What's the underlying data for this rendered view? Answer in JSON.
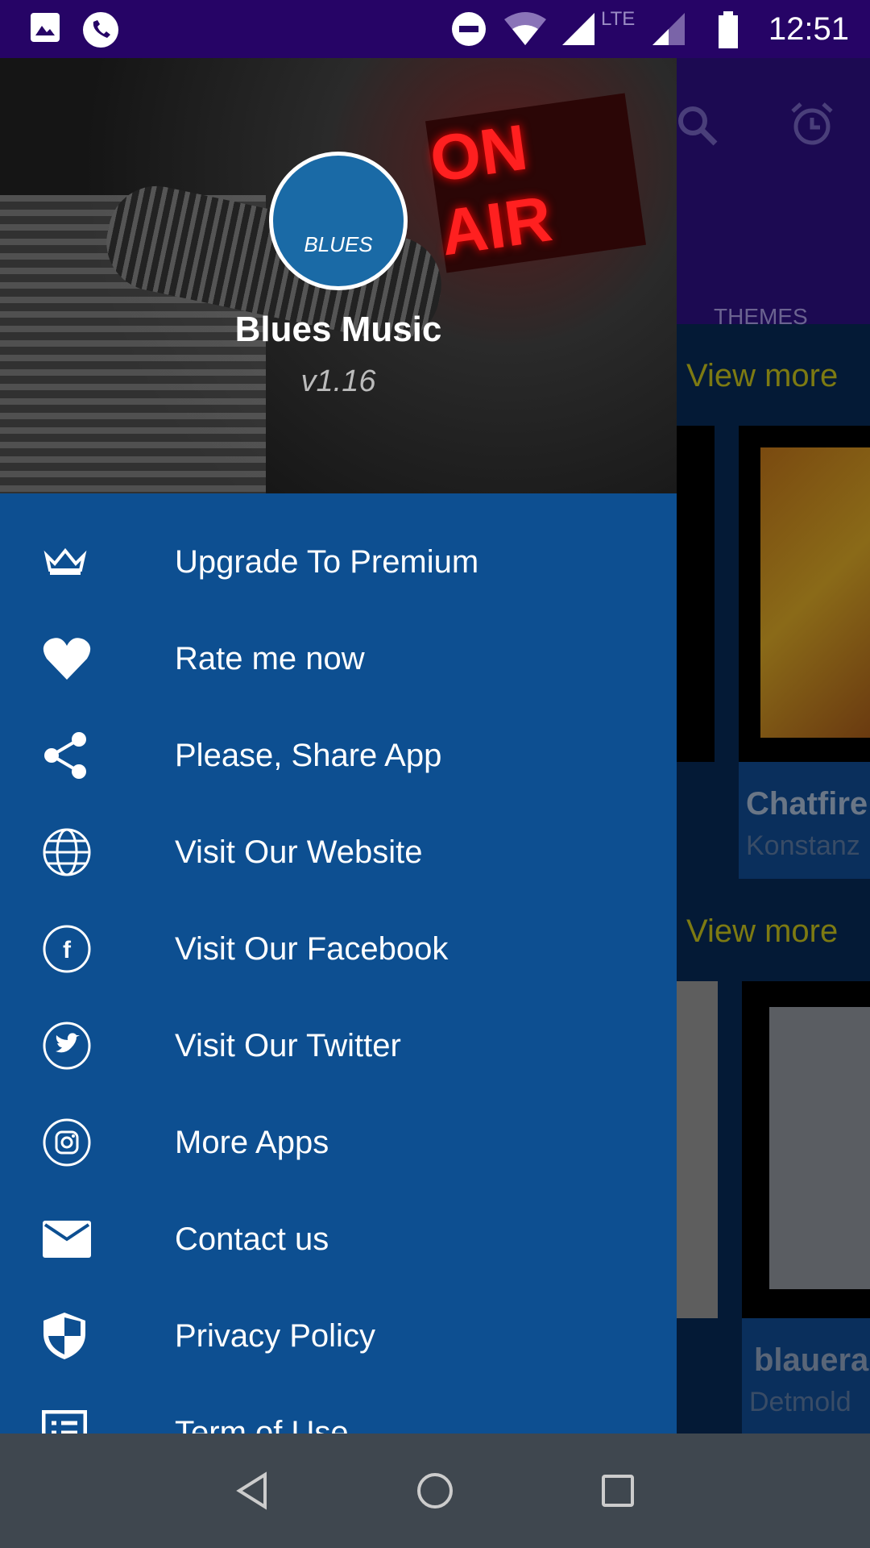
{
  "status_bar": {
    "time": "12:51",
    "network": "LTE"
  },
  "background": {
    "tab": "THEMES",
    "view_more_1": "View more",
    "view_more_2": "View more",
    "card1_title": "Chatfire",
    "card1_sub": "Konstanz",
    "card2_title": "blauera",
    "card2_sub": "Detmold"
  },
  "drawer": {
    "header_sign": "ON AIR",
    "logo_text": "BLUES",
    "app_name": "Blues Music",
    "version": "v1.16",
    "items": [
      {
        "label": "Upgrade To Premium",
        "icon": "crown-icon"
      },
      {
        "label": "Rate me now",
        "icon": "heart-icon"
      },
      {
        "label": "Please, Share App",
        "icon": "share-icon"
      },
      {
        "label": "Visit Our Website",
        "icon": "globe-icon"
      },
      {
        "label": "Visit Our Facebook",
        "icon": "facebook-icon"
      },
      {
        "label": "Visit Our Twitter",
        "icon": "twitter-icon"
      },
      {
        "label": "More Apps",
        "icon": "instagram-icon"
      },
      {
        "label": "Contact us",
        "icon": "mail-icon"
      },
      {
        "label": "Privacy Policy",
        "icon": "shield-icon"
      },
      {
        "label": "Term of Use",
        "icon": "list-icon"
      }
    ]
  },
  "colors": {
    "drawer": "#0d4f91",
    "status": "#260466",
    "accent": "#7d7a12"
  }
}
